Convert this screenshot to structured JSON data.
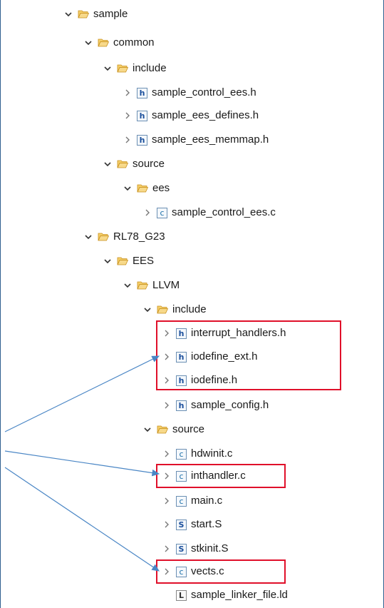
{
  "tree": [
    {
      "label": "sample",
      "kind": "folder",
      "state": "expanded"
    },
    {
      "label": "common",
      "kind": "folder",
      "state": "expanded"
    },
    {
      "label": "include",
      "kind": "folder",
      "state": "expanded"
    },
    {
      "label": "sample_control_ees.h",
      "kind": "h",
      "state": "collapsed"
    },
    {
      "label": "sample_ees_defines.h",
      "kind": "h",
      "state": "collapsed"
    },
    {
      "label": "sample_ees_memmap.h",
      "kind": "h",
      "state": "collapsed"
    },
    {
      "label": "source",
      "kind": "folder",
      "state": "expanded"
    },
    {
      "label": "ees",
      "kind": "folder",
      "state": "expanded"
    },
    {
      "label": "sample_control_ees.c",
      "kind": "c",
      "state": "collapsed"
    },
    {
      "label": "RL78_G23",
      "kind": "folder",
      "state": "expanded"
    },
    {
      "label": "EES",
      "kind": "folder",
      "state": "expanded"
    },
    {
      "label": "LLVM",
      "kind": "folder",
      "state": "expanded"
    },
    {
      "label": "include",
      "kind": "folder",
      "state": "expanded"
    },
    {
      "label": "interrupt_handlers.h",
      "kind": "h",
      "state": "collapsed"
    },
    {
      "label": "iodefine_ext.h",
      "kind": "h",
      "state": "collapsed"
    },
    {
      "label": "iodefine.h",
      "kind": "h",
      "state": "collapsed"
    },
    {
      "label": "sample_config.h",
      "kind": "h",
      "state": "collapsed"
    },
    {
      "label": "source",
      "kind": "folder",
      "state": "expanded"
    },
    {
      "label": "hdwinit.c",
      "kind": "c",
      "state": "collapsed"
    },
    {
      "label": "inthandler.c",
      "kind": "c",
      "state": "collapsed"
    },
    {
      "label": "main.c",
      "kind": "c",
      "state": "collapsed"
    },
    {
      "label": "start.S",
      "kind": "s",
      "state": "collapsed"
    },
    {
      "label": "stkinit.S",
      "kind": "s",
      "state": "collapsed"
    },
    {
      "label": "vects.c",
      "kind": "c",
      "state": "collapsed"
    },
    {
      "label": "sample_linker_file.ld",
      "kind": "l",
      "state": "none"
    }
  ],
  "icons": {
    "h": "h",
    "c": "c",
    "s": "S",
    "l": "L"
  },
  "colors": {
    "highlight": "#e0102a",
    "arrow": "#4a86c5",
    "folder": "#e8b13a"
  }
}
